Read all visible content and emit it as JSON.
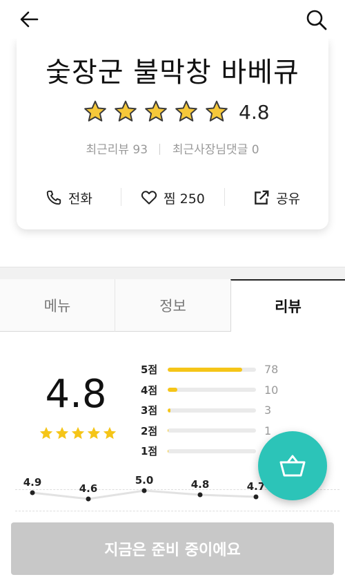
{
  "store": {
    "name": "숯장군 불막창 바베큐",
    "rating": "4.8",
    "star_count": 5,
    "recent_reviews": "최근리뷰 93",
    "owner_comments": "최근사장님댓글 0"
  },
  "actions": {
    "call": "전화",
    "like": "찜 250",
    "share": "공유"
  },
  "tabs": [
    "메뉴",
    "정보",
    "리뷰"
  ],
  "active_tab": "리뷰",
  "review_summary": {
    "score": "4.8",
    "star_color": "#f5c518",
    "distribution": [
      {
        "label": "5점",
        "count": "78",
        "fraction": 0.84
      },
      {
        "label": "4점",
        "count": "10",
        "fraction": 0.11
      },
      {
        "label": "3점",
        "count": "3",
        "fraction": 0.03
      },
      {
        "label": "2점",
        "count": "1",
        "fraction": 0.01
      },
      {
        "label": "1점",
        "count": "",
        "fraction": 0.01
      }
    ]
  },
  "trend": {
    "values": [
      4.9,
      4.6,
      5.0,
      4.8,
      4.7
    ],
    "labels": [
      "4.9",
      "4.6",
      "5.0",
      "4.8",
      "4.7"
    ]
  },
  "order_button": "지금은 준비 중이에요",
  "colors": {
    "accent": "#f5c518",
    "fab": "#2cc4b8",
    "disabled_button": "#c8c8c8"
  },
  "icons": {
    "back": "arrow-left-icon",
    "search": "search-icon",
    "phone": "phone-icon",
    "heart": "heart-icon",
    "share": "share-icon",
    "basket": "basket-icon"
  }
}
